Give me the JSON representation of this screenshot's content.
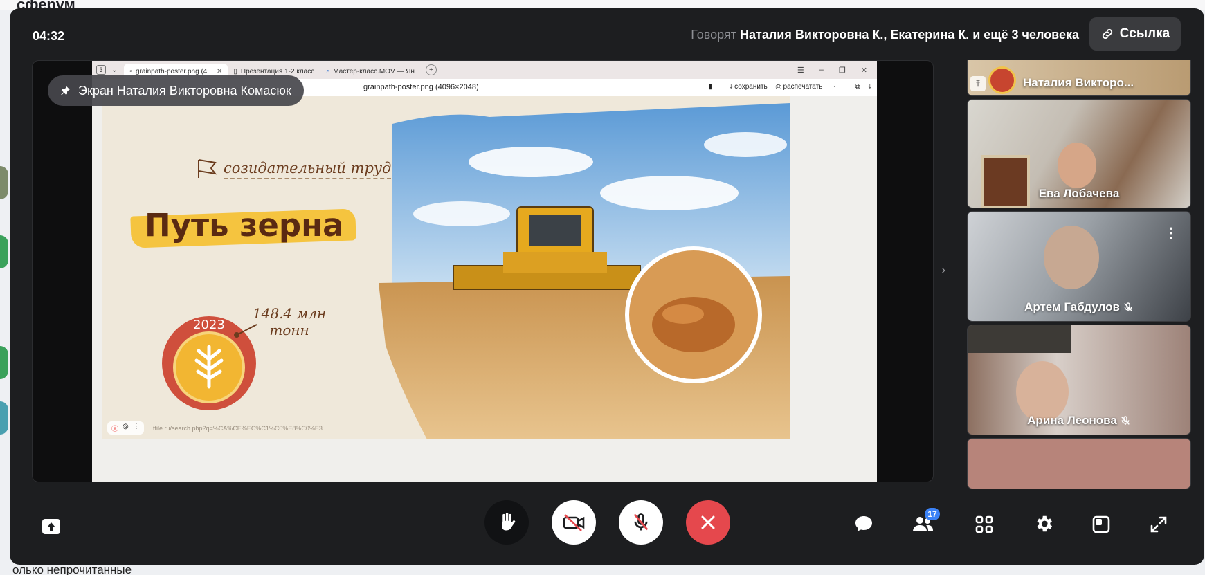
{
  "background": {
    "app_title": "сферум",
    "bottom_text": "олько непрочитанные"
  },
  "call": {
    "timer": "04:32",
    "speakers_prefix": "Говорят",
    "speakers_names": "Наталия Викторовна К., Екатерина К. и ещё 3 человека",
    "link_button": "Ссылка",
    "screen_badge": "Экран Наталия Викторовна Комасюк"
  },
  "browser": {
    "tab_count": "3",
    "tabs": [
      {
        "label": "grainpath-poster.png (4"
      },
      {
        "label": "Презентация 1-2 класс"
      },
      {
        "label": "Мастер-класс.MOV — Ян"
      }
    ],
    "address_title": "grainpath-poster.png (4096×2048)",
    "save_label": "сохранить",
    "print_label": "распечатать",
    "url_hint": "tfile.ru/search.php?q=%CA%CE%EC%C1%C0%E8%C0%E3"
  },
  "poster": {
    "tagline": "созидательный труд",
    "title": "Путь зерна",
    "year": "2023",
    "amount_line1": "148.4 млн",
    "amount_line2": "тонн"
  },
  "participants": [
    {
      "name": "Наталия Викторо...",
      "muted": false
    },
    {
      "name": "Ева Лобачева",
      "muted": false
    },
    {
      "name": "Артем Габдулов",
      "muted": true
    },
    {
      "name": "Арина Леонова",
      "muted": true
    }
  ],
  "toolbar": {
    "participants_count": "17"
  },
  "colors": {
    "accent_red": "#e5484d",
    "badge_blue": "#3b82f6"
  }
}
